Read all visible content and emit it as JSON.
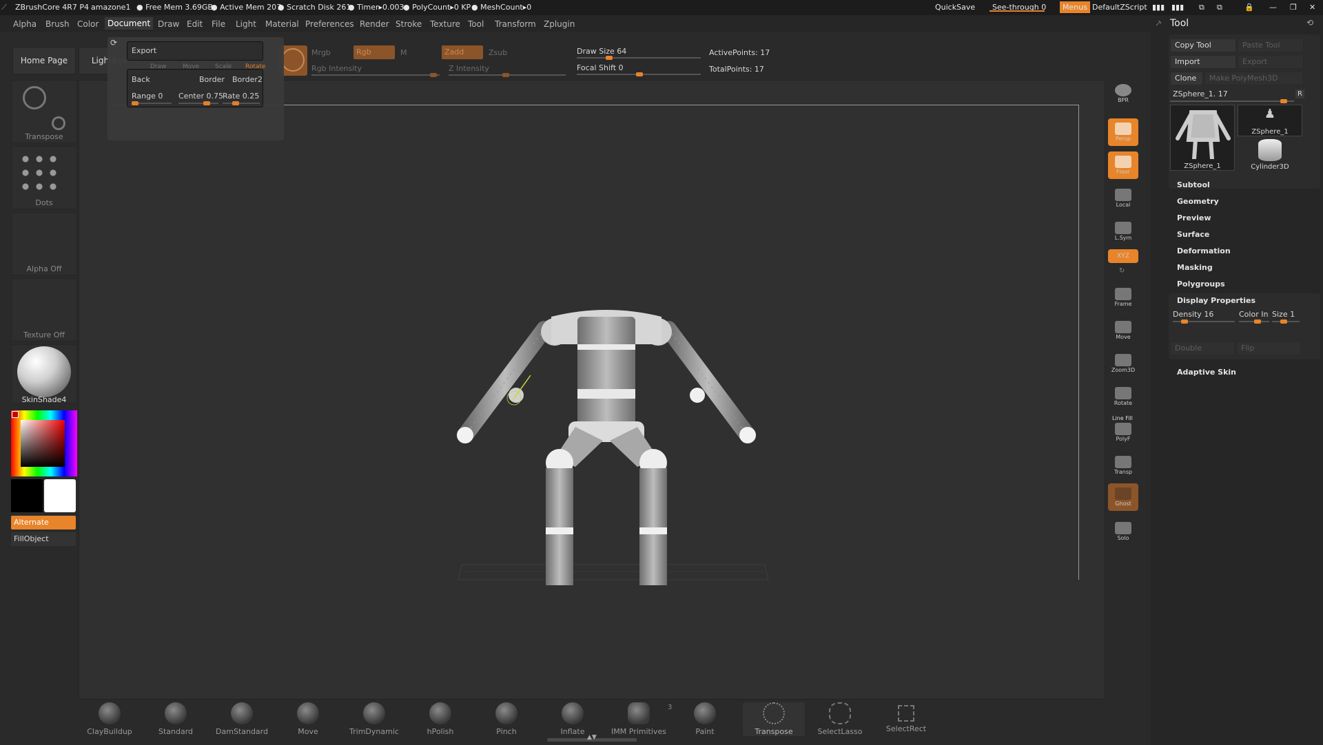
{
  "app": {
    "title": "ZBrushCore 4R7 P4",
    "doc": "amazone1",
    "free_mem": "● Free Mem 3.69GB",
    "active_mem": "● Active Mem 207",
    "scratch": "● Scratch Disk 261",
    "timer": "● Timer▸0.003",
    "polycount": "● PolyCount▸0 KP",
    "meshcount": "● MeshCount▸0",
    "quicksave": "QuickSave",
    "see_through": "See-through  0",
    "menus": "Menus",
    "script": "DefaultZScript"
  },
  "menu": [
    "Alpha",
    "Brush",
    "Color",
    "Document",
    "Draw",
    "Edit",
    "File",
    "Light",
    "Material",
    "Preferences",
    "Render",
    "Stroke",
    "Texture",
    "Tool",
    "Transform",
    "Zplugin"
  ],
  "shelf": {
    "home": "Home Page",
    "lightbox": "LightBox",
    "mrgb": "Mrgb",
    "rgb": "Rgb",
    "m": "M",
    "zadd": "Zadd",
    "zsub": "Zsub",
    "rgb_intensity": "Rgb Intensity",
    "z_intensity": "Z Intensity",
    "draw_size": "Draw Size 64",
    "focal_shift": "Focal Shift 0",
    "active_points": "ActivePoints: 17",
    "total_points": "TotalPoints: 17"
  },
  "popup": {
    "export": "Export",
    "back": "Back",
    "border": "Border",
    "border2": "Border2",
    "range": "Range 0",
    "center": "Center 0.75",
    "rate": "Rate 0.25",
    "draw": "Draw",
    "move": "Move",
    "scale": "Scale",
    "rotate": "Rotate"
  },
  "left": {
    "transpose": "Transpose",
    "dots": "Dots",
    "alpha": "Alpha Off",
    "texture": "Texture Off",
    "material": "SkinShade4",
    "alternate": "Alternate",
    "fillobject": "FillObject"
  },
  "right": [
    {
      "label": "BPR"
    },
    {
      "label": "Persp"
    },
    {
      "label": "Floor"
    },
    {
      "label": "Local"
    },
    {
      "label": "L.Sym"
    },
    {
      "label": "XYZ"
    },
    {
      "label": "Frame"
    },
    {
      "label": "Move"
    },
    {
      "label": "Zoom3D"
    },
    {
      "label": "Rotate"
    },
    {
      "label": "PolyF"
    },
    {
      "label": "Transp"
    },
    {
      "label": "Ghost"
    },
    {
      "label": "Solo"
    }
  ],
  "right_extra": {
    "linefill": "Line Fill"
  },
  "tool": {
    "title": "Tool",
    "copy": "Copy Tool",
    "paste": "Paste Tool",
    "import": "Import",
    "export": "Export",
    "clone": "Clone",
    "make": "Make PolyMesh3D",
    "current": "ZSphere_1. 17",
    "r": "R",
    "thumbs": [
      "ZSphere_1",
      "ZSphere_1",
      "Cylinder3D"
    ],
    "sections": [
      "Subtool",
      "Geometry",
      "Preview",
      "Surface",
      "Deformation",
      "Masking",
      "Polygroups",
      "Display Properties"
    ],
    "density": "Density 16",
    "color_in": "Color In",
    "size": "Size 1",
    "double": "Double",
    "flip": "Flip",
    "adaptive": "Adaptive Skin"
  },
  "brushes": [
    "ClayBuildup",
    "Standard",
    "DamStandard",
    "Move",
    "TrimDynamic",
    "hPolish",
    "Pinch",
    "Inflate",
    "IMM Primitives",
    "Paint",
    "Transpose",
    "SelectLasso",
    "SelectRect"
  ],
  "imm_count": "3",
  "colors": {
    "accent": "#e8842a",
    "bg": "#2a2a2a"
  }
}
